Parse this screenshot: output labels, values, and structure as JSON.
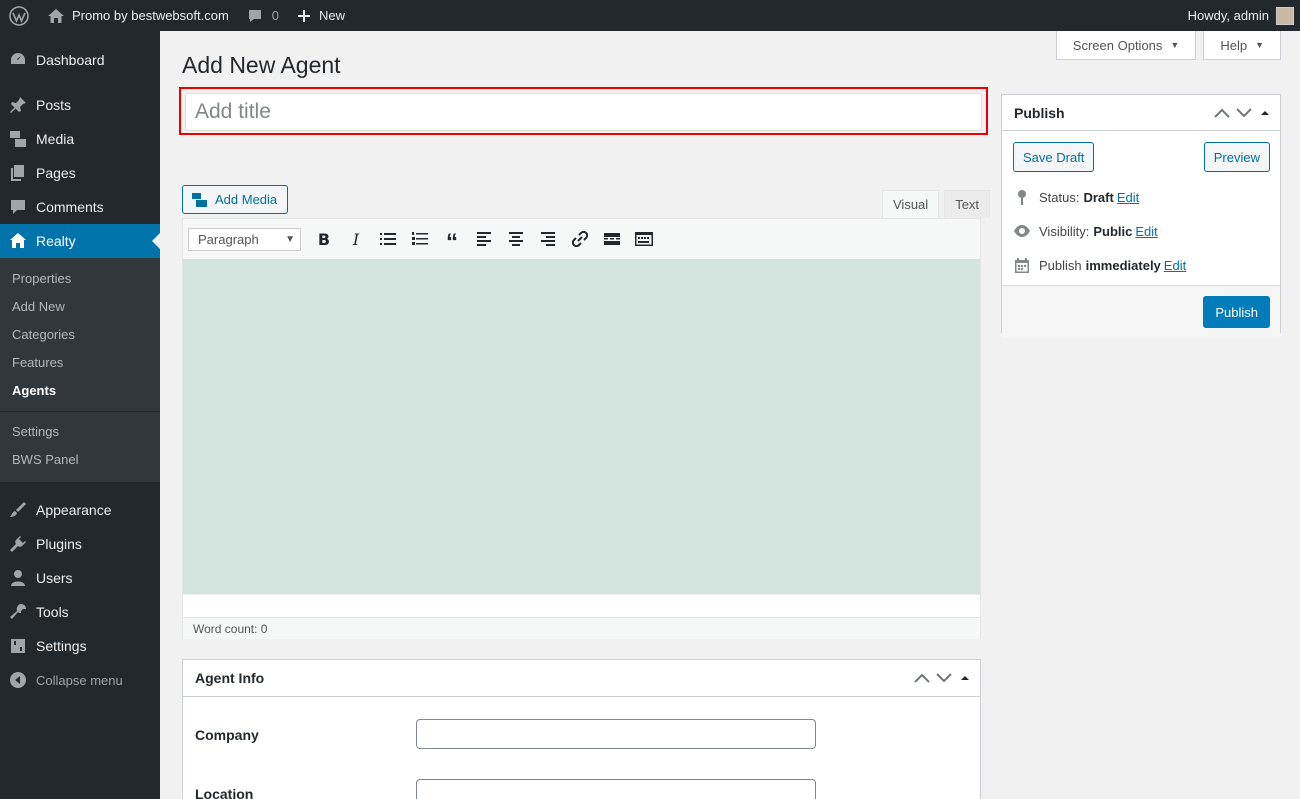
{
  "admin_bar": {
    "site_name": "Promo by bestwebsoft.com",
    "comments_count": "0",
    "new_label": "New",
    "howdy": "Howdy, admin"
  },
  "sidebar": {
    "items": [
      {
        "label": "Dashboard",
        "icon": "dashboard-icon"
      },
      {
        "label": "Posts",
        "icon": "pin-icon"
      },
      {
        "label": "Media",
        "icon": "media-icon"
      },
      {
        "label": "Pages",
        "icon": "pages-icon"
      },
      {
        "label": "Comments",
        "icon": "comments-icon"
      },
      {
        "label": "Realty",
        "icon": "home-icon"
      }
    ],
    "submenu": [
      "Properties",
      "Add New",
      "Categories",
      "Features",
      "Agents",
      "Settings",
      "BWS Panel"
    ],
    "lower_items": [
      {
        "label": "Appearance",
        "icon": "brush-icon"
      },
      {
        "label": "Plugins",
        "icon": "plugin-icon"
      },
      {
        "label": "Users",
        "icon": "users-icon"
      },
      {
        "label": "Tools",
        "icon": "wrench-icon"
      },
      {
        "label": "Settings",
        "icon": "settings-icon"
      }
    ],
    "collapse_label": "Collapse menu"
  },
  "screen_options": {
    "label": "Screen Options",
    "help": "Help"
  },
  "page": {
    "title": "Add New Agent",
    "title_placeholder": "Add title"
  },
  "editor": {
    "add_media": "Add Media",
    "tab_visual": "Visual",
    "tab_text": "Text",
    "format": "Paragraph",
    "word_count": "Word count: 0"
  },
  "publish": {
    "heading": "Publish",
    "save_draft": "Save Draft",
    "preview": "Preview",
    "status_label": "Status:",
    "status_value": "Draft",
    "visibility_label": "Visibility:",
    "visibility_value": "Public",
    "publish_label": "Publish",
    "publish_value": "immediately",
    "edit": "Edit",
    "publish_button": "Publish"
  },
  "agent_info": {
    "heading": "Agent Info",
    "company_label": "Company",
    "location_label": "Location"
  },
  "colors": {
    "accent": "#0073aa",
    "admin_bar": "#23282d",
    "highlight_border": "#e00000",
    "editor_bg": "#d4e4de"
  }
}
